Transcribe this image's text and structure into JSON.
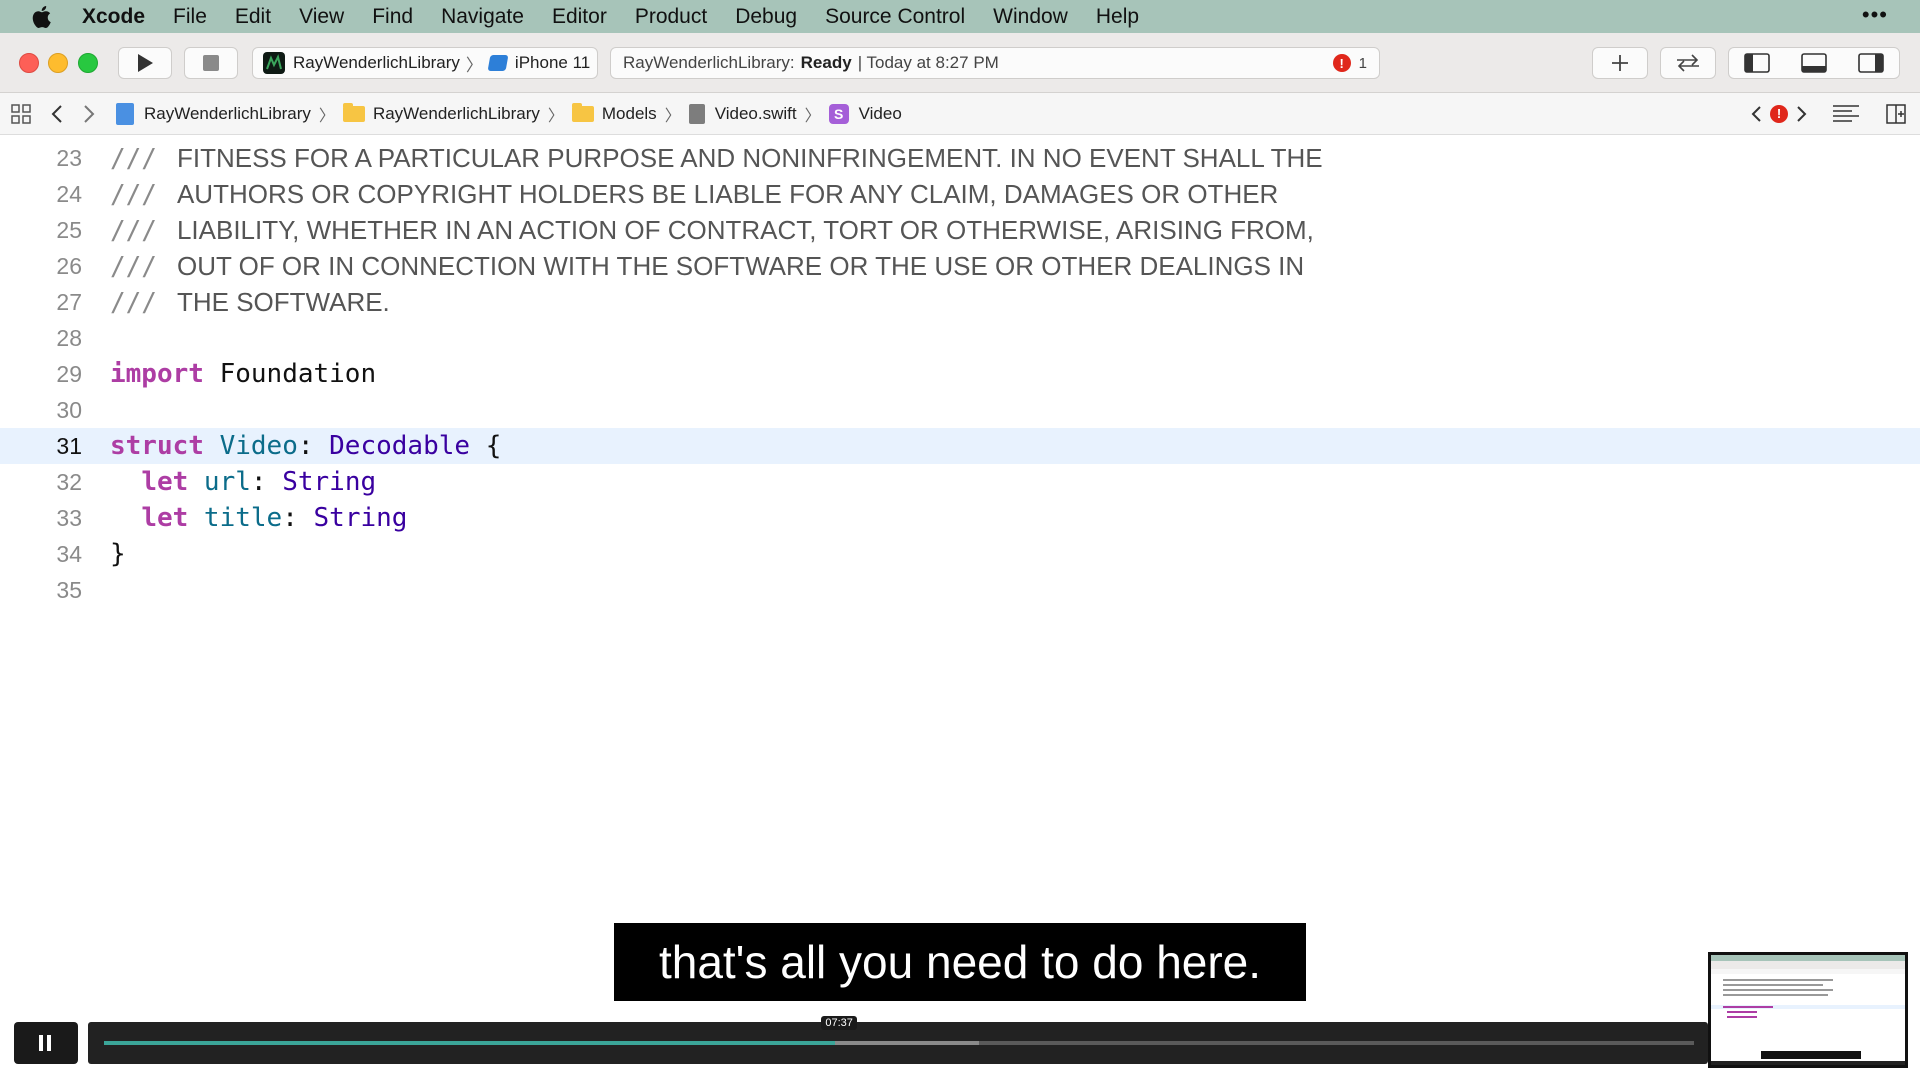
{
  "menubar": {
    "app_name": "Xcode",
    "items": [
      "File",
      "Edit",
      "View",
      "Find",
      "Navigate",
      "Editor",
      "Product",
      "Debug",
      "Source Control",
      "Window",
      "Help"
    ],
    "overflow": "•••"
  },
  "toolbar": {
    "scheme": "RayWenderlichLibrary",
    "device": "iPhone 11",
    "status_project": "RayWenderlichLibrary:",
    "status_state": "Ready",
    "status_time": "| Today at 8:27 PM",
    "error_count": "1"
  },
  "jumpbar": {
    "crumbs": [
      "RayWenderlichLibrary",
      "RayWenderlichLibrary",
      "Models",
      "Video.swift",
      "Video"
    ],
    "symbol_badge": "S"
  },
  "editor": {
    "lines": [
      {
        "num": "23",
        "comment": "FITNESS FOR A PARTICULAR PURPOSE AND NONINFRINGEMENT. IN NO EVENT SHALL THE"
      },
      {
        "num": "24",
        "comment": "AUTHORS OR COPYRIGHT HOLDERS BE LIABLE FOR ANY CLAIM, DAMAGES OR OTHER"
      },
      {
        "num": "25",
        "comment": "LIABILITY, WHETHER IN AN ACTION OF CONTRACT, TORT OR OTHERWISE, ARISING FROM,"
      },
      {
        "num": "26",
        "comment": "OUT OF OR IN CONNECTION WITH THE SOFTWARE OR THE USE OR OTHER DEALINGS IN"
      },
      {
        "num": "27",
        "comment": "THE SOFTWARE."
      },
      {
        "num": "28"
      },
      {
        "num": "29",
        "kw": "import",
        "rest": " Foundation"
      },
      {
        "num": "30"
      },
      {
        "num": "31",
        "kw": "struct",
        "name": " Video",
        "colon": ": ",
        "type": "Decodable",
        "tail": " {"
      },
      {
        "num": "32",
        "kw": "let",
        "name": " url",
        "colon": ": ",
        "type": "String"
      },
      {
        "num": "33",
        "kw": "let",
        "name": " title",
        "colon": ": ",
        "type": "String"
      },
      {
        "num": "34",
        "tail": "}"
      },
      {
        "num": "35"
      }
    ],
    "comment_marker": "///"
  },
  "subtitle": "that's all you need to do here.",
  "player": {
    "time": "07:37",
    "progress": 0.46,
    "buffered": 0.55
  },
  "colors": {
    "menubar_bg": "#a7c4b9",
    "keyword": "#ad3da4",
    "type": "#3900a0",
    "identifier": "#0b6c8a",
    "progress": "#3ba598"
  }
}
